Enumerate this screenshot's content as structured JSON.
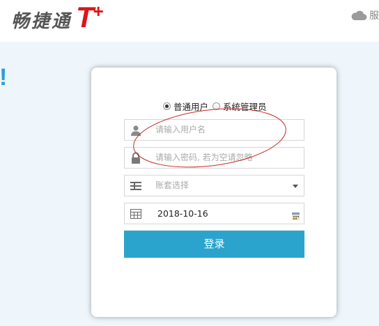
{
  "header": {
    "logo_text": "畅捷通",
    "logo_mark": "T",
    "logo_plus": "+",
    "service_label": "服"
  },
  "page": {
    "exclaim": "!"
  },
  "login": {
    "roles": [
      {
        "label": "普通用户",
        "checked": true
      },
      {
        "label": "系统管理员",
        "checked": false
      }
    ],
    "username_placeholder": "请输入用户名",
    "password_placeholder": "请输入密码, 若为空请忽略",
    "account_placeholder": "账套选择",
    "date_value": "2018-10-16",
    "login_label": "登录"
  },
  "icons": {
    "user": "user-icon",
    "lock": "lock-icon",
    "list": "list-icon",
    "calendar": "calendar-icon",
    "cloud": "cloud-icon"
  },
  "colors": {
    "brand_red": "#d9161c",
    "button_blue": "#2aa4cc",
    "background": "#eef6fb",
    "annotation_red": "#c8282a"
  }
}
